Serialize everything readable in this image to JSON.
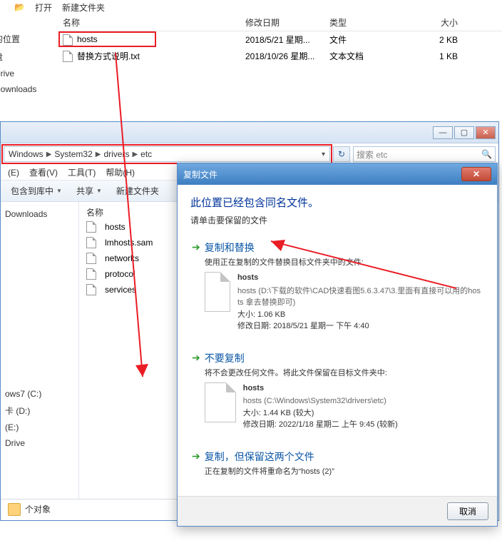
{
  "top": {
    "toolbar": {
      "open": "打开",
      "newFolder": "新建文件夹"
    },
    "headers": {
      "name": "名称",
      "date": "修改日期",
      "type": "类型",
      "size": "大小"
    },
    "files": [
      {
        "name": "hosts",
        "date": "2018/5/21 星期...",
        "type": "文件",
        "size": "2 KB"
      },
      {
        "name": "替换方式说明.txt",
        "date": "2018/10/26 星期...",
        "type": "文本文档",
        "size": "1 KB"
      }
    ],
    "nav": [
      "的位置",
      "盘",
      "Drive",
      "Downloads"
    ]
  },
  "bottom": {
    "breadcrumb": [
      "Windows",
      "System32",
      "drivers",
      "etc"
    ],
    "searchPlaceholder": "搜索 etc",
    "menu": [
      "(E)",
      "查看(V)",
      "工具(T)",
      "帮助(H)"
    ],
    "toolbar": [
      "包含到库中",
      "共享",
      "新建文件夹"
    ],
    "nav1": [
      "Downloads"
    ],
    "filesHeader": "名称",
    "files": [
      "hosts",
      "lmhosts.sam",
      "networks",
      "protocol",
      "services"
    ],
    "nav2": [
      "ows7 (C:)",
      "卡 (D:)",
      "(E:)",
      "Drive"
    ],
    "status": "个对象"
  },
  "dialog": {
    "title": "复制文件",
    "heading": "此位置已经包含同名文件。",
    "sub": "请单击要保留的文件",
    "opt1": {
      "title": "复制和替换",
      "desc": "使用正在复制的文件替换目标文件夹中的文件:",
      "fname": "hosts",
      "fpath": "hosts (D:\\下载的软件\\CAD快速看图5.6.3.47\\3.里面有直接可以用的hosts 拿去替换即可)",
      "fsize": "大小: 1.06 KB",
      "fdate": "修改日期: 2018/5/21 星期一 下午 4:40"
    },
    "opt2": {
      "title": "不要复制",
      "desc": "将不会更改任何文件。将此文件保留在目标文件夹中:",
      "fname": "hosts",
      "fpath": "hosts (C:\\Windows\\System32\\drivers\\etc)",
      "fsize": "大小: 1.44 KB (较大)",
      "fdate": "修改日期: 2022/1/18 星期二 上午 9:45 (较新)"
    },
    "opt3": {
      "title": "复制，但保留这两个文件",
      "desc": "正在复制的文件将重命名为“hosts (2)”"
    },
    "cancel": "取消"
  }
}
